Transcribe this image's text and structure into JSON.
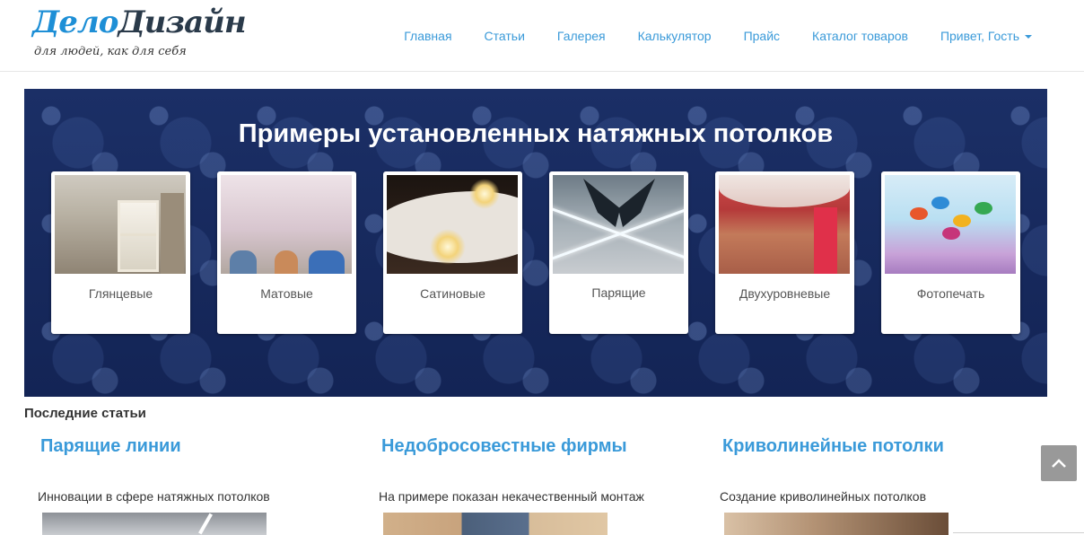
{
  "logo": {
    "part1": "Дело",
    "part2": "Дизайн",
    "tagline": "для людей, как для себя"
  },
  "nav": {
    "items": [
      {
        "label": "Главная"
      },
      {
        "label": "Статьи"
      },
      {
        "label": "Галерея"
      },
      {
        "label": "Калькулятор"
      },
      {
        "label": "Прайс"
      },
      {
        "label": "Каталог товаров"
      }
    ],
    "user_menu": "Привет, Гость"
  },
  "hero": {
    "title": "Примеры установленных натяжных потолков",
    "cards": [
      {
        "label": "Глянцевые"
      },
      {
        "label": "Матовые"
      },
      {
        "label": "Сатиновые"
      },
      {
        "label": "Парящие"
      },
      {
        "label": "Двухуровневые"
      },
      {
        "label": "Фотопечать"
      }
    ]
  },
  "latest": {
    "heading": "Последние статьи",
    "articles": [
      {
        "title": "Парящие линии",
        "text": "Инновации в сфере натяжных потолков"
      },
      {
        "title": "Недобросовестные фирмы",
        "text": "На примере показан некачественный монтаж"
      },
      {
        "title": "Криволинейные потолки",
        "text": "Создание криволинейных потолков"
      }
    ]
  },
  "colors": {
    "link": "#3a9ad9",
    "hero_bg": "#16285a",
    "logo_blue": "#1e8fd6"
  },
  "icons": {
    "scroll_top": "chevron-up-icon",
    "dropdown": "caret-down-icon"
  }
}
